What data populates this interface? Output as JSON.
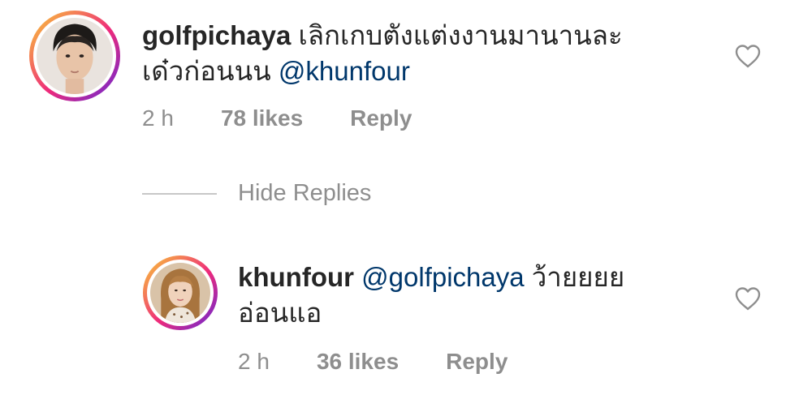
{
  "comments": [
    {
      "username": "golfpichaya",
      "text_line1": "เลิกเกบตังแต่งงานมานานละ",
      "text_line2": "เด๋วก่อนนน",
      "mention": "@khunfour",
      "time": "2 h",
      "likes": "78 likes",
      "reply_label": "Reply"
    },
    {
      "username": "khunfour",
      "mention": "@golfpichaya",
      "text_line1": "ว้ายยยย",
      "text_line2": "อ่อนแอ",
      "time": "2 h",
      "likes": "36 likes",
      "reply_label": "Reply"
    }
  ],
  "hide_replies_label": "Hide Replies",
  "colors": {
    "text": "#262626",
    "meta": "#8e8e8e",
    "mention": "#00376b",
    "story_ring_start": "#f9ce34",
    "story_ring_end": "#ee2a7b"
  },
  "icons": {
    "like": "heart-outline-icon"
  }
}
